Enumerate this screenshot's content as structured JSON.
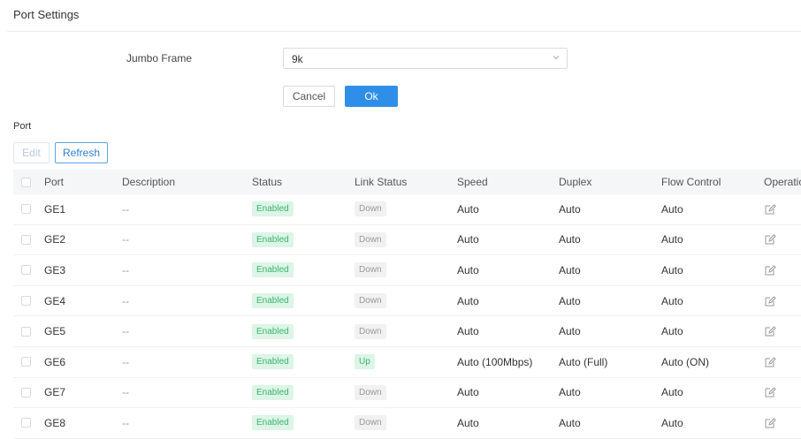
{
  "page": {
    "title": "Port Settings"
  },
  "jumbo_frame": {
    "label": "Jumbo Frame",
    "value": "9k"
  },
  "form_buttons": {
    "cancel": "Cancel",
    "ok": "Ok"
  },
  "port_section": {
    "label": "Port"
  },
  "toolbar": {
    "edit": "Edit",
    "refresh": "Refresh"
  },
  "table": {
    "headers": [
      "Port",
      "Description",
      "Status",
      "Link Status",
      "Speed",
      "Duplex",
      "Flow Control",
      "Operatio"
    ],
    "rows": [
      {
        "port": "GE1",
        "description": "--",
        "status": "Enabled",
        "link": "Down",
        "speed": "Auto",
        "duplex": "Auto",
        "flow": "Auto"
      },
      {
        "port": "GE2",
        "description": "--",
        "status": "Enabled",
        "link": "Down",
        "speed": "Auto",
        "duplex": "Auto",
        "flow": "Auto"
      },
      {
        "port": "GE3",
        "description": "--",
        "status": "Enabled",
        "link": "Down",
        "speed": "Auto",
        "duplex": "Auto",
        "flow": "Auto"
      },
      {
        "port": "GE4",
        "description": "--",
        "status": "Enabled",
        "link": "Down",
        "speed": "Auto",
        "duplex": "Auto",
        "flow": "Auto"
      },
      {
        "port": "GE5",
        "description": "--",
        "status": "Enabled",
        "link": "Down",
        "speed": "Auto",
        "duplex": "Auto",
        "flow": "Auto"
      },
      {
        "port": "GE6",
        "description": "--",
        "status": "Enabled",
        "link": "Up",
        "speed": "Auto (100Mbps)",
        "duplex": "Auto (Full)",
        "flow": "Auto (ON)"
      },
      {
        "port": "GE7",
        "description": "--",
        "status": "Enabled",
        "link": "Down",
        "speed": "Auto",
        "duplex": "Auto",
        "flow": "Auto"
      },
      {
        "port": "GE8",
        "description": "--",
        "status": "Enabled",
        "link": "Down",
        "speed": "Auto",
        "duplex": "Auto",
        "flow": "Auto"
      }
    ]
  },
  "colors": {
    "primary": "#2f8fe8",
    "enabled_badge": "#3bb46e",
    "header_bg": "#f5f6f8"
  }
}
